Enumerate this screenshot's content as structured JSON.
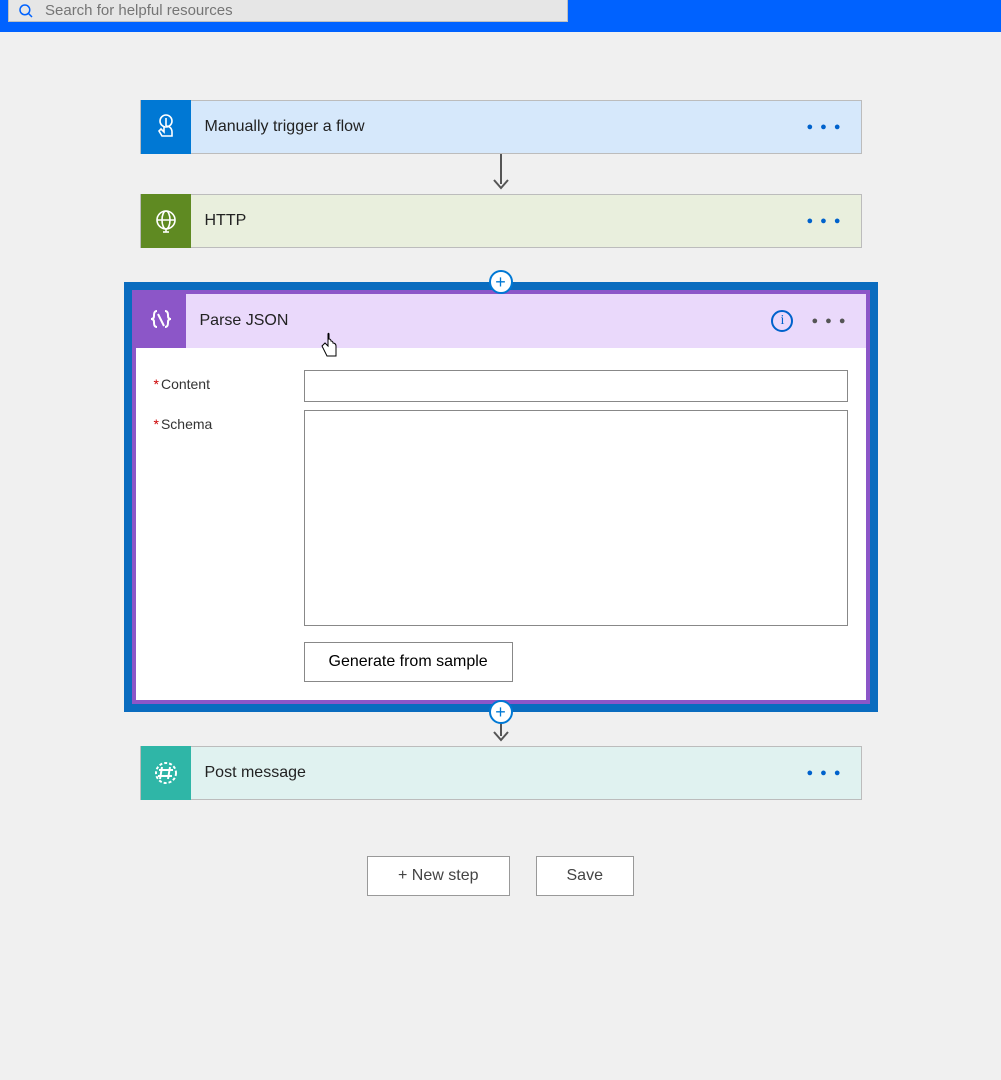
{
  "search": {
    "placeholder": "Search for helpful resources"
  },
  "flow": {
    "trigger": {
      "title": "Manually trigger a flow"
    },
    "http": {
      "title": "HTTP"
    },
    "parse_json": {
      "title": "Parse JSON",
      "fields": {
        "content_label": "Content",
        "content_value": "",
        "schema_label": "Schema",
        "schema_value": ""
      },
      "generate_button": "Generate from sample"
    },
    "post_message": {
      "title": "Post message"
    }
  },
  "footer": {
    "new_step": "+ New step",
    "save": "Save"
  },
  "glyphs": {
    "ellipsis": "● ● ●",
    "info": "i",
    "plus": "+"
  }
}
